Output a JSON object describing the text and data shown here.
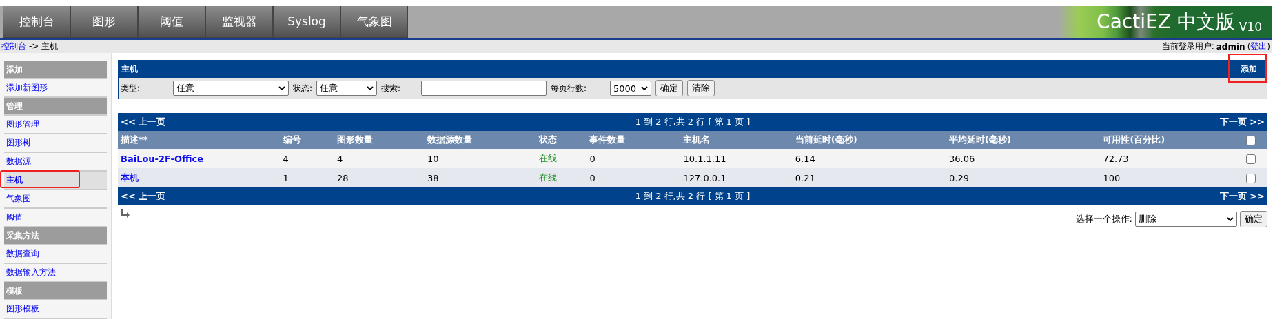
{
  "top_tabs": [
    {
      "label": "控制台",
      "selected": false
    },
    {
      "label": "图形",
      "selected": false
    },
    {
      "label": "阈值",
      "selected": false
    },
    {
      "label": "监视器",
      "selected": false
    },
    {
      "label": "Syslog",
      "selected": false
    },
    {
      "label": "气象图",
      "selected": false
    }
  ],
  "logo": {
    "name": "CactiEZ 中文版",
    "version": "V10"
  },
  "breadcrumb": {
    "link": "控制台",
    "current": "-> 主机"
  },
  "login": {
    "label": "当前登录用户:",
    "user": "admin",
    "paren_open": "(",
    "logout": "登出",
    "paren_close": ")"
  },
  "sidebar": [
    {
      "kind": "header",
      "label": "添加"
    },
    {
      "kind": "item",
      "label": "添加新图形",
      "selected": false,
      "highlighted": false
    },
    {
      "kind": "header",
      "label": "管理"
    },
    {
      "kind": "item",
      "label": "图形管理",
      "selected": false,
      "highlighted": false
    },
    {
      "kind": "item",
      "label": "图形树",
      "selected": false,
      "highlighted": false
    },
    {
      "kind": "item",
      "label": "数据源",
      "selected": false,
      "highlighted": false
    },
    {
      "kind": "item",
      "label": "主机",
      "selected": true,
      "highlighted": true
    },
    {
      "kind": "item",
      "label": "气象图",
      "selected": false,
      "highlighted": false
    },
    {
      "kind": "item",
      "label": "阈值",
      "selected": false,
      "highlighted": false
    },
    {
      "kind": "header",
      "label": "采集方法"
    },
    {
      "kind": "item",
      "label": "数据查询",
      "selected": false,
      "highlighted": false
    },
    {
      "kind": "item",
      "label": "数据输入方法",
      "selected": false,
      "highlighted": false
    },
    {
      "kind": "header",
      "label": "模板"
    },
    {
      "kind": "item",
      "label": "图形模板",
      "selected": false,
      "highlighted": false
    }
  ],
  "filter_panel": {
    "title": "主机",
    "add_button": {
      "label": "添加",
      "highlighted": true
    },
    "type_label": "类型:",
    "type_value": "任意",
    "status_label": "状态:",
    "status_value": "任意",
    "search_label": "搜索:",
    "rows_label": "每页行数:",
    "rows_value": "5000",
    "go_button": "确定",
    "clear_button": "清除"
  },
  "table": {
    "nav_top": {
      "prev": "<< 上一页",
      "info": "1 到 2 行,共 2 行 [ 第 1 页 ]",
      "next": "下一页 >>"
    },
    "columns": [
      "描述**",
      "编号",
      "图形数量",
      "数据源数量",
      "状态",
      "事件数量",
      "主机名",
      "当前延时(毫秒)",
      "平均延时(毫秒)",
      "可用性(百分比)"
    ],
    "select_all_checked": false,
    "rows": [
      {
        "cells": [
          "BaiLou-2F-Office",
          "4",
          "4",
          "10",
          "在线",
          "0",
          "10.1.1.11",
          "6.14",
          "36.06",
          "72.73"
        ],
        "checked": false
      },
      {
        "cells": [
          "本机",
          "1",
          "28",
          "38",
          "在线",
          "0",
          "127.0.0.1",
          "0.21",
          "0.29",
          "100"
        ],
        "checked": false
      }
    ],
    "nav_bottom": {
      "prev": "<< 上一页",
      "info": "1 到 2 行,共 2 行 [ 第 1 页 ]",
      "next": "下一页 >>"
    }
  },
  "actions": {
    "label": "选择一个操作:",
    "value": "删除",
    "go_button": "确定"
  }
}
